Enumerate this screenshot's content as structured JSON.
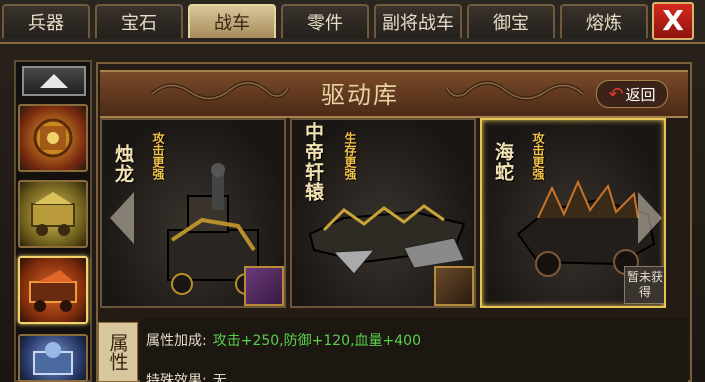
{
  "tabs": [
    {
      "label": "兵器",
      "active": false
    },
    {
      "label": "宝石",
      "active": false
    },
    {
      "label": "战车",
      "active": true
    },
    {
      "label": "零件",
      "active": false
    },
    {
      "label": "副将战车",
      "active": false
    },
    {
      "label": "御宝",
      "active": false
    },
    {
      "label": "熔炼",
      "active": false
    }
  ],
  "close_button": {
    "label": "X"
  },
  "banner": {
    "title": "驱动库",
    "return_label": "返回"
  },
  "cards": [
    {
      "name": "烛龙",
      "tag": "攻击更强",
      "selected": false,
      "status": ""
    },
    {
      "name": "中帝轩辕",
      "tag": "生存更强",
      "selected": false,
      "status": ""
    },
    {
      "name": "海蛇",
      "tag": "攻击更强",
      "selected": true,
      "status": "暂未获得"
    }
  ],
  "attributes": {
    "side_label": "属性",
    "bonus_label": "属性加成:",
    "bonus_value": "攻击+250,防御+120,血量+400",
    "special_label": "特殊效果:",
    "special_value": "无"
  },
  "colors": {
    "accent_gold": "#e9c457",
    "close_red": "#c8231a",
    "bonus_green": "#58d04a"
  }
}
